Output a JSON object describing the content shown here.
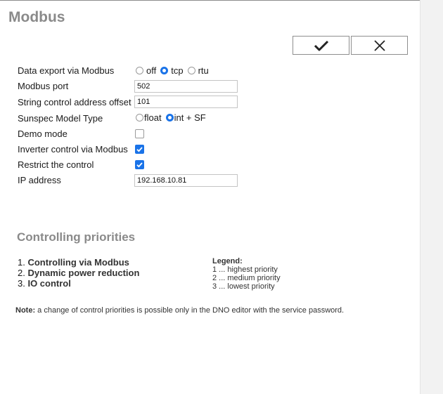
{
  "title": "Modbus",
  "actions": {
    "confirm_icon": "checkmark-icon",
    "cancel_icon": "close-icon"
  },
  "form": {
    "data_export": {
      "label": "Data export via Modbus",
      "options": [
        "off",
        "tcp",
        "rtu"
      ],
      "selected": "tcp"
    },
    "modbus_port": {
      "label": "Modbus port",
      "value": "502"
    },
    "string_offset": {
      "label": "String control address offset",
      "value": "101"
    },
    "sunspec": {
      "label": "Sunspec Model Type",
      "options": [
        "float",
        "int + SF"
      ],
      "selected": "int + SF"
    },
    "demo_mode": {
      "label": "Demo mode",
      "checked": false
    },
    "inverter_control": {
      "label": "Inverter control via Modbus",
      "checked": true
    },
    "restrict": {
      "label": "Restrict the control",
      "checked": true
    },
    "ip_address": {
      "label": "IP address",
      "value": "192.168.10.81"
    }
  },
  "priorities": {
    "title": "Controlling priorities",
    "items": [
      {
        "num": "1.",
        "label": "Controlling via Modbus"
      },
      {
        "num": "2.",
        "label": "Dynamic power reduction"
      },
      {
        "num": "3.",
        "label": "IO control"
      }
    ],
    "legend_title": "Legend:",
    "legend": [
      "1 ... highest priority",
      "2 ... medium priority",
      "3 ... lowest priority"
    ]
  },
  "note": {
    "prefix": "Note:",
    "text": " a change of control priorities is possible only in the DNO editor with the service password."
  },
  "colors": {
    "accent": "#1a73e8",
    "heading": "#8a8a8a"
  }
}
